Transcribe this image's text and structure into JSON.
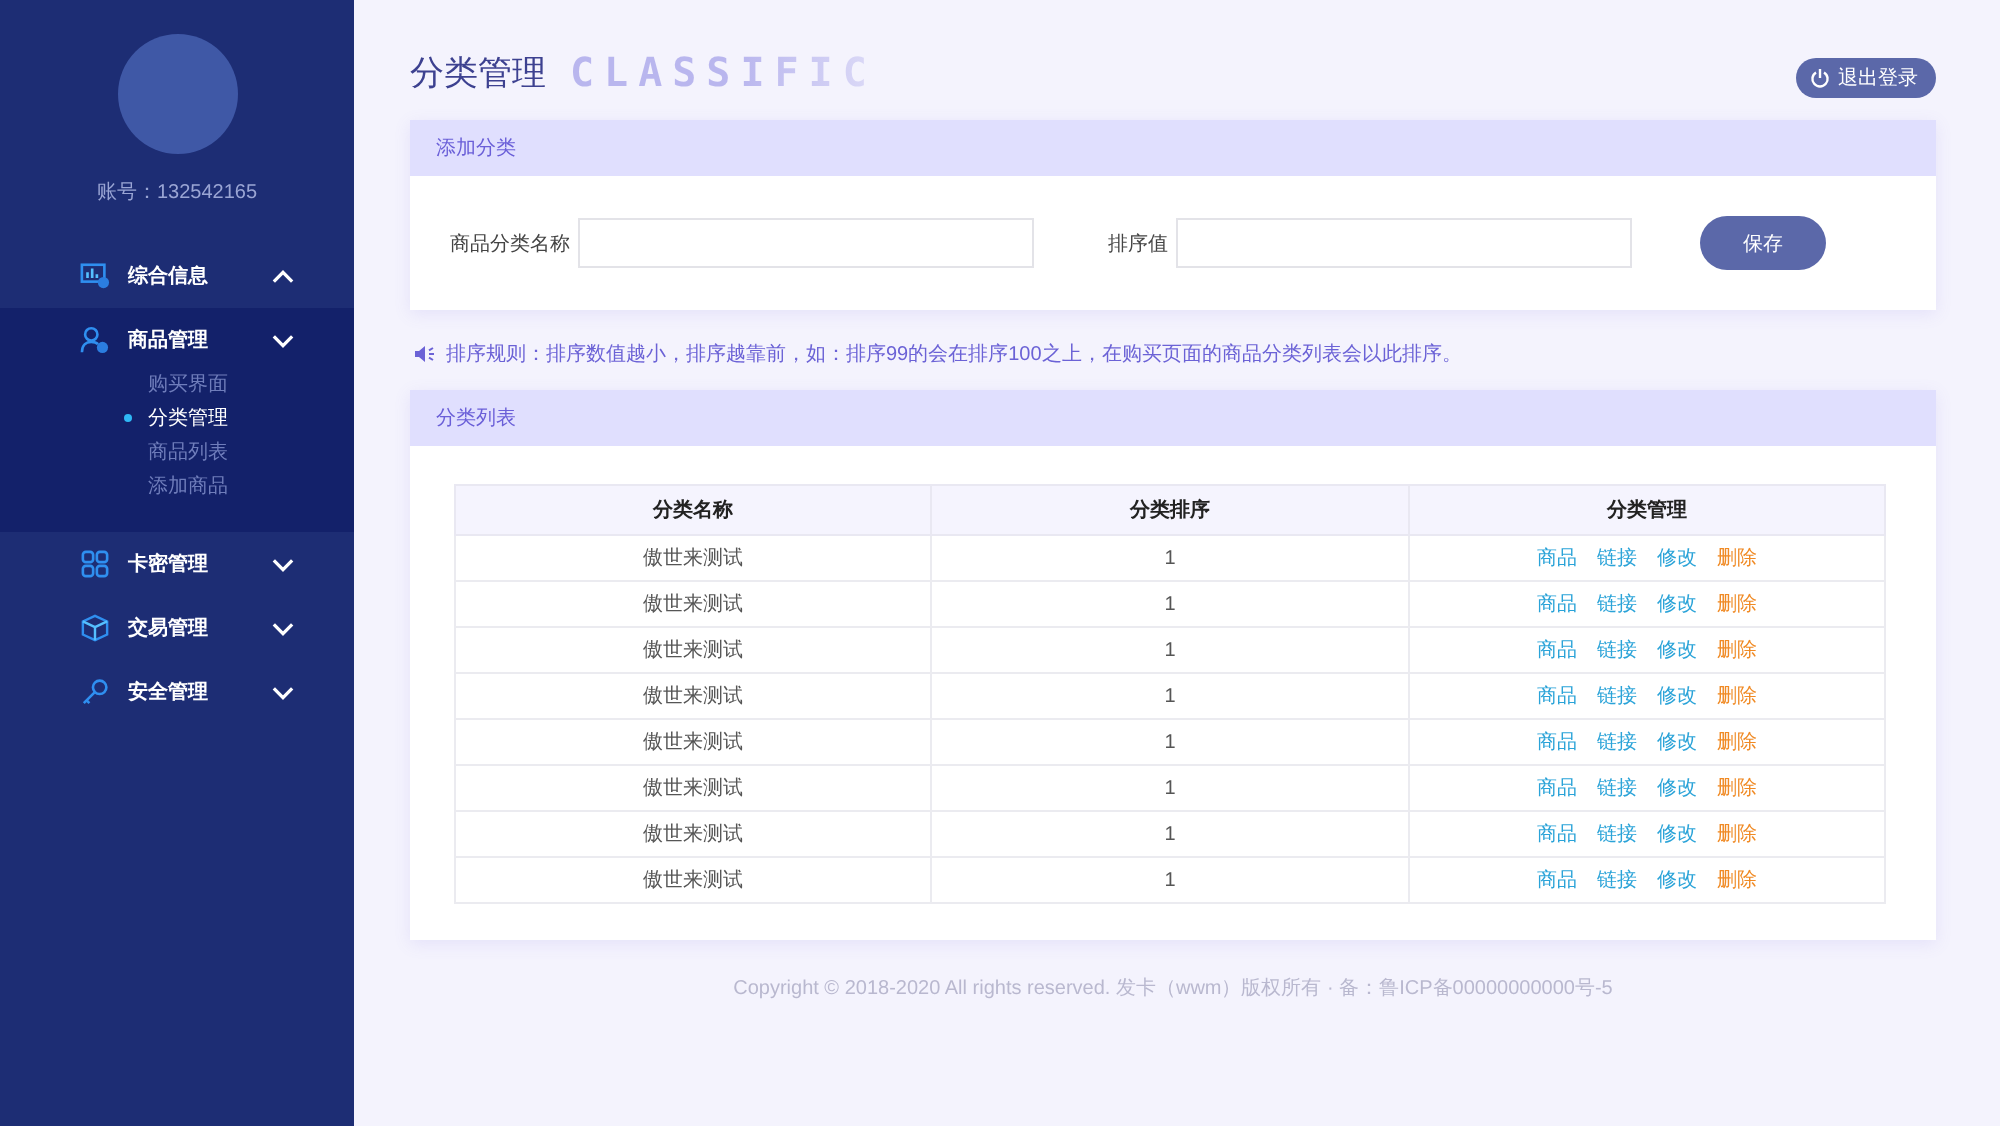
{
  "sidebar": {
    "account": "账号：132542165",
    "menu": [
      {
        "label": "综合信息",
        "expanded": true,
        "selected": false
      },
      {
        "label": "商品管理",
        "expanded": false,
        "selected": true,
        "children": [
          {
            "label": "购买界面",
            "selected": false
          },
          {
            "label": "分类管理",
            "selected": true
          },
          {
            "label": "商品列表",
            "selected": false
          },
          {
            "label": "添加商品",
            "selected": false
          }
        ]
      },
      {
        "label": "卡密管理",
        "expanded": false,
        "selected": false
      },
      {
        "label": "交易管理",
        "expanded": false,
        "selected": false
      },
      {
        "label": "安全管理",
        "expanded": false,
        "selected": false
      }
    ]
  },
  "header": {
    "title": "分类管理",
    "subtitle": "CLASSIFIC",
    "logout": "退出登录"
  },
  "add_panel": {
    "title": "添加分类",
    "fields": [
      {
        "label": "商品分类名称"
      },
      {
        "label": "排序值"
      }
    ],
    "save": "保存"
  },
  "notice": "排序规则：排序数值越小，排序越靠前，如：排序99的会在排序100之上，在购买页面的商品分类列表会以此排序。",
  "list_panel": {
    "title": "分类列表",
    "table": {
      "columns": [
        "分类名称",
        "分类排序",
        "分类管理"
      ],
      "rows": [
        {
          "name": "傲世来测试",
          "order": "1",
          "actions": [
            {
              "label": "商品",
              "kind": "link"
            },
            {
              "label": "链接",
              "kind": "link"
            },
            {
              "label": "修改",
              "kind": "link"
            },
            {
              "label": "删除",
              "kind": "danger"
            }
          ]
        },
        {
          "name": "傲世来测试",
          "order": "1",
          "actions": [
            {
              "label": "商品",
              "kind": "link"
            },
            {
              "label": "链接",
              "kind": "link"
            },
            {
              "label": "修改",
              "kind": "link"
            },
            {
              "label": "删除",
              "kind": "danger"
            }
          ]
        },
        {
          "name": "傲世来测试",
          "order": "1",
          "actions": [
            {
              "label": "商品",
              "kind": "link"
            },
            {
              "label": "链接",
              "kind": "link"
            },
            {
              "label": "修改",
              "kind": "link"
            },
            {
              "label": "删除",
              "kind": "danger"
            }
          ]
        },
        {
          "name": "傲世来测试",
          "order": "1",
          "actions": [
            {
              "label": "商品",
              "kind": "link"
            },
            {
              "label": "链接",
              "kind": "link"
            },
            {
              "label": "修改",
              "kind": "link"
            },
            {
              "label": "删除",
              "kind": "danger"
            }
          ]
        },
        {
          "name": "傲世来测试",
          "order": "1",
          "actions": [
            {
              "label": "商品",
              "kind": "link"
            },
            {
              "label": "链接",
              "kind": "link"
            },
            {
              "label": "修改",
              "kind": "link"
            },
            {
              "label": "删除",
              "kind": "danger"
            }
          ]
        },
        {
          "name": "傲世来测试",
          "order": "1",
          "actions": [
            {
              "label": "商品",
              "kind": "link"
            },
            {
              "label": "链接",
              "kind": "link"
            },
            {
              "label": "修改",
              "kind": "link"
            },
            {
              "label": "删除",
              "kind": "danger"
            }
          ]
        },
        {
          "name": "傲世来测试",
          "order": "1",
          "actions": [
            {
              "label": "商品",
              "kind": "link"
            },
            {
              "label": "链接",
              "kind": "link"
            },
            {
              "label": "修改",
              "kind": "link"
            },
            {
              "label": "删除",
              "kind": "danger"
            }
          ]
        },
        {
          "name": "傲世来测试",
          "order": "1",
          "actions": [
            {
              "label": "商品",
              "kind": "link"
            },
            {
              "label": "链接",
              "kind": "link"
            },
            {
              "label": "修改",
              "kind": "link"
            },
            {
              "label": "删除",
              "kind": "danger"
            }
          ]
        }
      ]
    }
  },
  "footer": "Copyright © 2018-2020 All rights reserved. 发卡（wwm）版权所有 · 备：鲁ICP备00000000000号-5"
}
